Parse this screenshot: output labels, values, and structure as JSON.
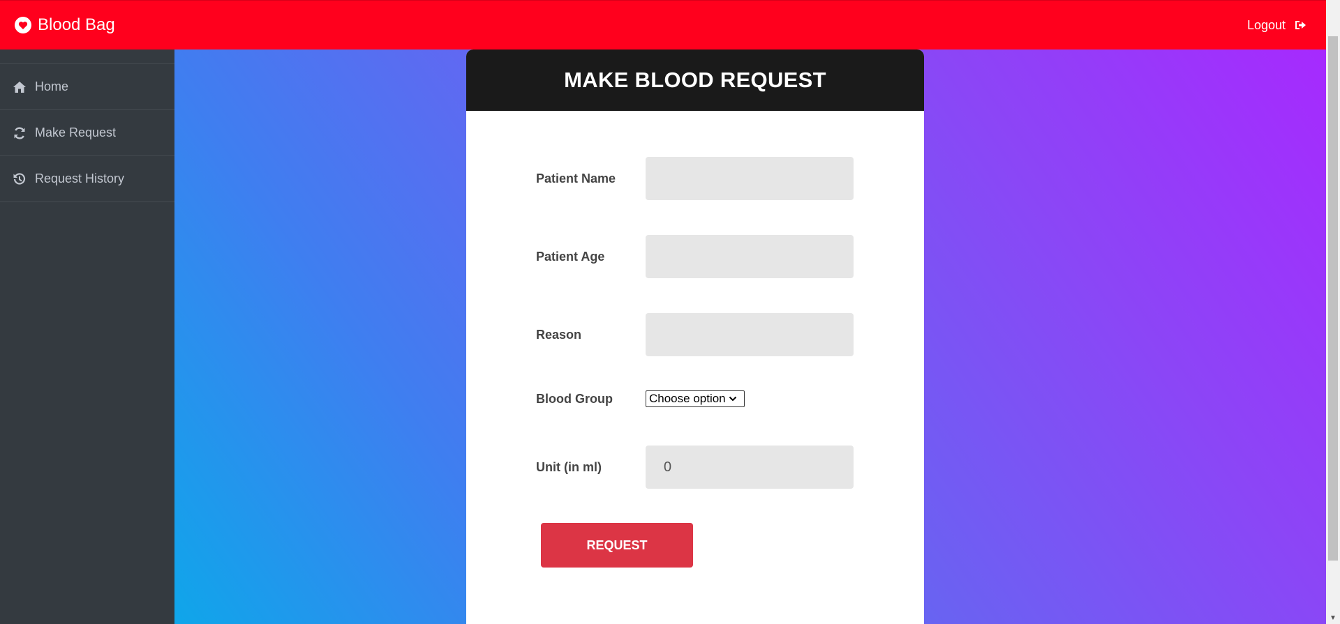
{
  "navbar": {
    "brand": "Blood Bag",
    "brand_icon": "heart-circle-icon",
    "logout_label": "Logout",
    "logout_icon": "sign-out-icon",
    "background_color": "#ff001d"
  },
  "sidebar": {
    "items": [
      {
        "label": "Home",
        "icon": "home-icon"
      },
      {
        "label": "Make Request",
        "icon": "refresh-icon"
      },
      {
        "label": "Request History",
        "icon": "history-icon"
      }
    ]
  },
  "form": {
    "title": "MAKE BLOOD REQUEST",
    "fields": {
      "patient_name": {
        "label": "Patient Name",
        "value": ""
      },
      "patient_age": {
        "label": "Patient Age",
        "value": ""
      },
      "reason": {
        "label": "Reason",
        "value": ""
      },
      "blood_group": {
        "label": "Blood Group",
        "selected": "Choose option"
      },
      "unit": {
        "label": "Unit (in ml)",
        "value": "0"
      }
    },
    "submit_label": "REQUEST",
    "submit_color": "#dc3545"
  }
}
